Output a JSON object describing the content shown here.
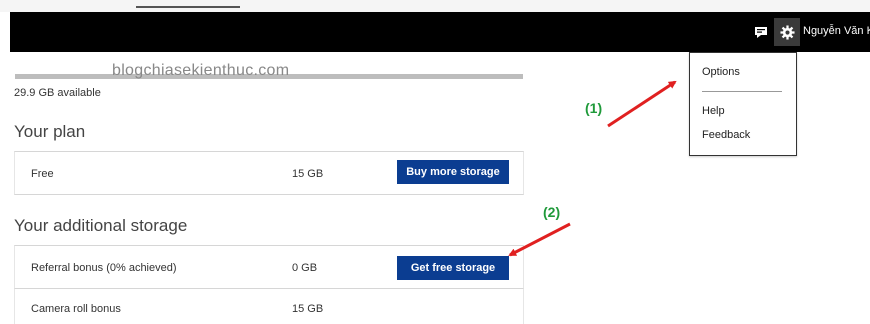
{
  "header": {
    "user_name": "Nguyễn Văn Kiê",
    "feedback_icon": "feedback-icon",
    "settings_icon": "gear-icon"
  },
  "storage": {
    "watermark": "blogchiasekienthuc.com",
    "available": "29.9 GB available"
  },
  "plan": {
    "title": "Your plan",
    "row": {
      "label": "Free",
      "size": "15 GB",
      "button": "Buy more storage"
    }
  },
  "additional": {
    "title": "Your additional storage",
    "rows": [
      {
        "label": "Referral bonus (0% achieved)",
        "size": "0 GB",
        "button": "Get free storage"
      },
      {
        "label": "Camera roll bonus",
        "size": "15 GB"
      }
    ]
  },
  "settings_menu": {
    "items": [
      "Options",
      "Help",
      "Feedback"
    ]
  },
  "annotations": {
    "one": "(1)",
    "two": "(2)",
    "color": "#1f9a3a",
    "arrow_color": "#e02020"
  },
  "colors": {
    "topbar": "#000000",
    "primary_button": "#0b3d91"
  }
}
